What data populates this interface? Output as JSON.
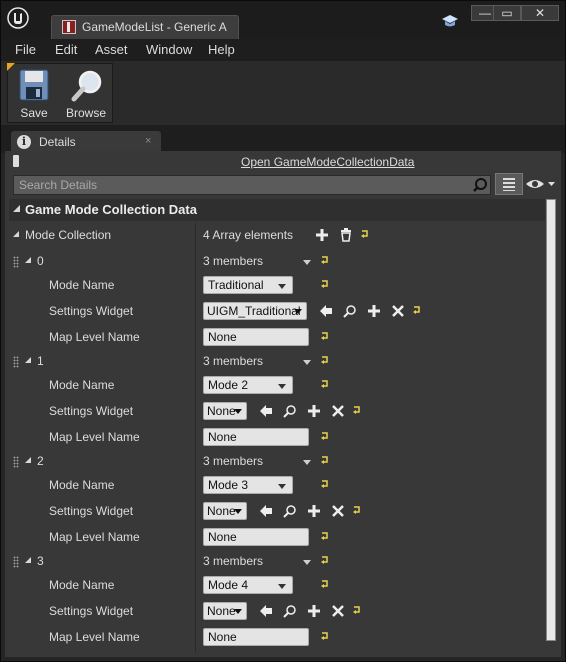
{
  "window": {
    "tab_title": "GameModeList - Generic A",
    "tab_close": "×",
    "min_label": "—",
    "max_label": "▭",
    "close_label": "✕"
  },
  "menu": {
    "items": [
      "File",
      "Edit",
      "Asset",
      "Window",
      "Help"
    ]
  },
  "toolbar": {
    "save_label": "Save",
    "browse_label": "Browse"
  },
  "details": {
    "tab_label": "Details",
    "tab_close": "×",
    "open_link": "Open GameModeCollectionData",
    "search_placeholder": "Search Details",
    "category": "Game Mode Collection Data",
    "collection_label": "Mode Collection",
    "collection_value": "4 Array elements",
    "field_mode_name": "Mode Name",
    "field_settings_widget": "Settings Widget",
    "field_map_level": "Map Level Name",
    "elements": [
      {
        "index": "0",
        "members": "3 members",
        "mode_name": "Traditional",
        "settings_widget": "UIGM_Traditional",
        "map_level": "None"
      },
      {
        "index": "1",
        "members": "3 members",
        "mode_name": "Mode 2",
        "settings_widget": "None",
        "map_level": "None"
      },
      {
        "index": "2",
        "members": "3 members",
        "mode_name": "Mode 3",
        "settings_widget": "None",
        "map_level": "None"
      },
      {
        "index": "3",
        "members": "3 members",
        "mode_name": "Mode 4",
        "settings_widget": "None",
        "map_level": "None"
      }
    ]
  },
  "colors": {
    "background": "#383838",
    "titlebar": "#1c1c1c",
    "accent_reset": "#e8d44d",
    "toolbar_corner": "#e8a41a"
  },
  "icons": [
    "unreal-logo-icon",
    "blueprint-asset-icon",
    "learn-cap-icon",
    "save-icon",
    "browse-icon",
    "details-info-icon",
    "pin-icon",
    "search-icon",
    "view-options-icon",
    "eye-icon",
    "add-icon",
    "delete-icon",
    "reset-to-default-icon",
    "use-selected-icon",
    "browse-asset-icon",
    "clear-icon",
    "drag-grip-icon"
  ]
}
